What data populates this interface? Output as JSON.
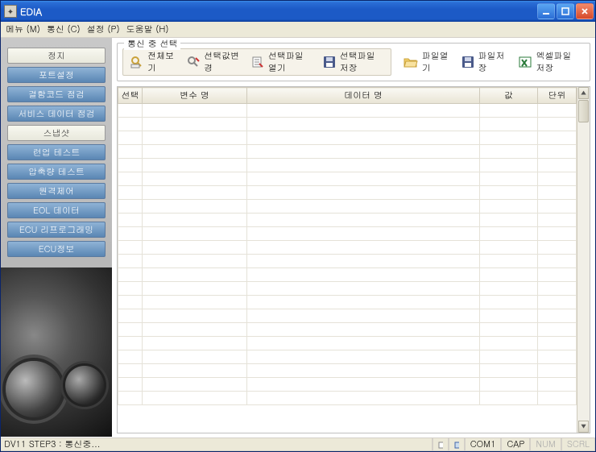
{
  "window": {
    "title": "EDIA"
  },
  "menu": {
    "items": [
      "메뉴 (M)",
      "통신 (C)",
      "설정 (P)",
      "도움말 (H)"
    ]
  },
  "sidebar": {
    "items": [
      {
        "label": "정지",
        "sel": true
      },
      {
        "label": "포트설정"
      },
      {
        "label": "결함코드 점검"
      },
      {
        "label": "서비스 데이터 점검"
      },
      {
        "label": "스냅샷",
        "sel": true
      },
      {
        "label": "런업 테스트"
      },
      {
        "label": "압축량 테스트"
      },
      {
        "label": "원격제어"
      },
      {
        "label": "EOL 데이터"
      },
      {
        "label": "ECU 리프로그래밍"
      },
      {
        "label": "ECU정보"
      }
    ]
  },
  "group": {
    "label": "통신 중 선택"
  },
  "toolbar": {
    "group": [
      "전체보기",
      "선택값변경",
      "선택파일열기",
      "선택파일저장"
    ],
    "rest": [
      "파일열기",
      "파일저장",
      "엑셀파일저장"
    ]
  },
  "table": {
    "headers": [
      "선택",
      "변수 명",
      "데이터 명",
      "값",
      "단위"
    ]
  },
  "status": {
    "text": "DV11 STEP3 : 통신중...",
    "cells": [
      "COM1",
      "CAP",
      "NUM",
      "SCRL"
    ]
  }
}
